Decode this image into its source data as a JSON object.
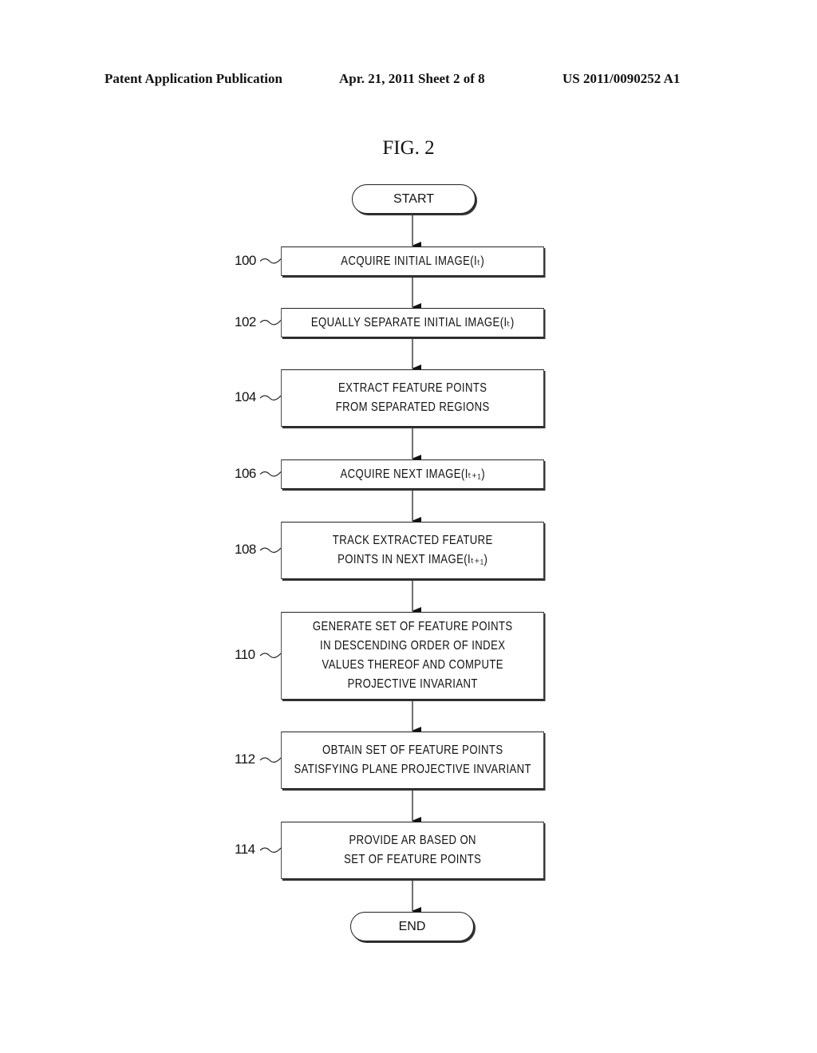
{
  "header": {
    "publication": "Patent Application Publication",
    "date_sheet": "Apr. 21, 2011  Sheet 2 of 8",
    "number": "US 2011/0090252 A1"
  },
  "figure": {
    "title": "FIG. 2",
    "start_label": "START",
    "end_label": "END",
    "steps": [
      {
        "ref": "100",
        "lines": [
          "ACQUIRE  INITIAL  IMAGE(Iₜ)"
        ]
      },
      {
        "ref": "102",
        "lines": [
          "EQUALLY SEPARATE  INITIAL  IMAGE(Iₜ)"
        ]
      },
      {
        "ref": "104",
        "lines": [
          "EXTRACT FEATURE POINTS",
          "FROM SEPARATED REGIONS"
        ]
      },
      {
        "ref": "106",
        "lines": [
          "ACQUIRE NEXT  IMAGE(Iₜ₊₁)"
        ]
      },
      {
        "ref": "108",
        "lines": [
          "TRACK EXTRACTED FEATURE",
          "POINTS  IN NEXT  IMAGE(Iₜ₊₁)"
        ]
      },
      {
        "ref": "110",
        "lines": [
          "GENERATE SET OF FEATURE POINTS",
          "IN DESCENDING ORDER OF INDEX",
          "VALUES THEREOF AND COMPUTE",
          "PROJECTIVE  INVARIANT"
        ]
      },
      {
        "ref": "112",
        "lines": [
          "OBTAIN SET OF FEATURE POINTS",
          "SATISFYING PLANE PROJECTIVE  INVARIANT"
        ]
      },
      {
        "ref": "114",
        "lines": [
          "PROVIDE AR BASED ON",
          "SET OF FEATURE POINTS"
        ]
      }
    ]
  }
}
